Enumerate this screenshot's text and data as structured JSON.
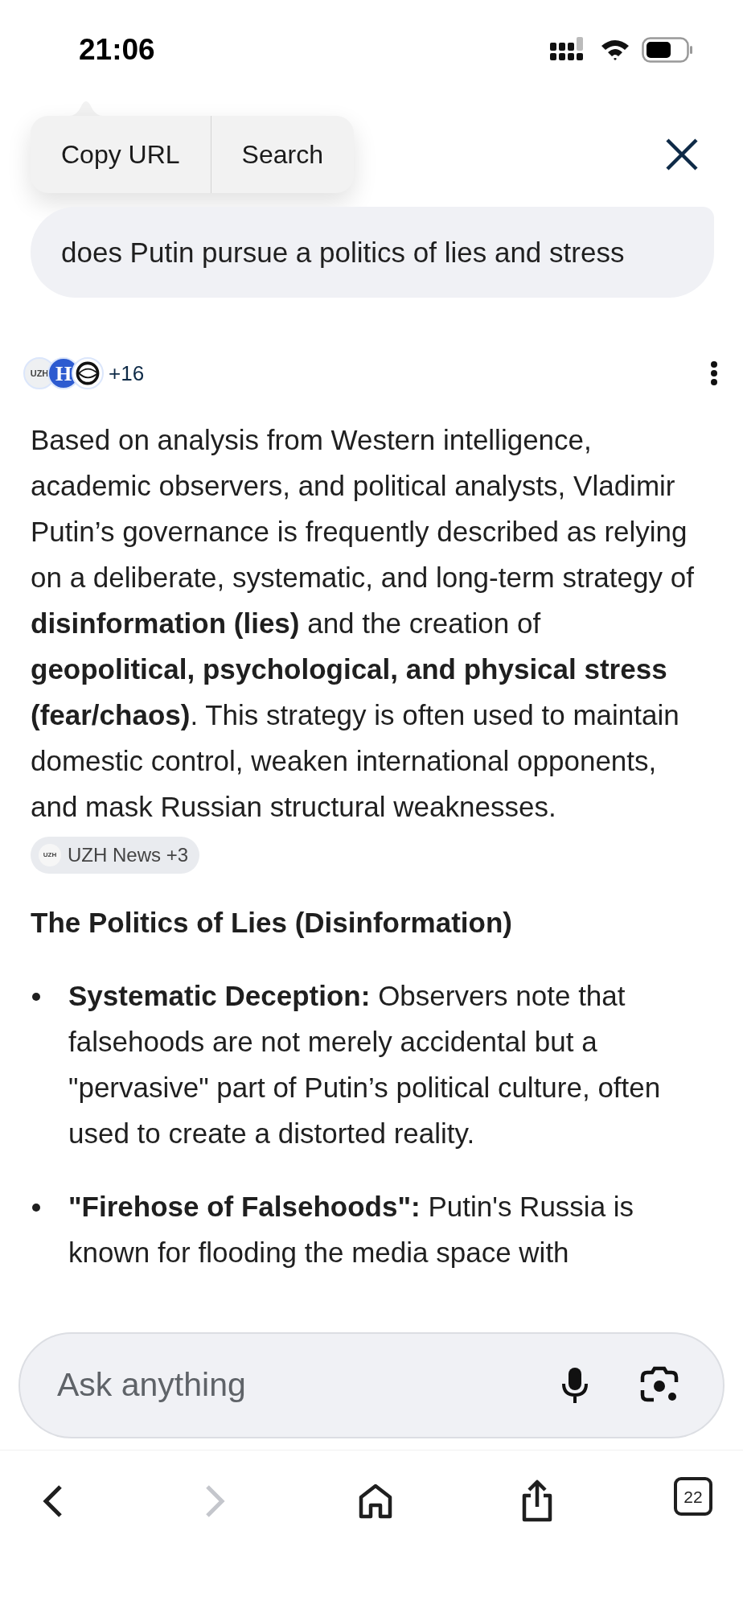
{
  "status_bar": {
    "time": "21:06"
  },
  "popup_menu": {
    "items": [
      "Copy URL",
      "Search"
    ]
  },
  "query": "does Putin pursue a politics of lies and stress",
  "sources": {
    "avatars": [
      {
        "kind": "text",
        "label": "UZH"
      },
      {
        "kind": "letter",
        "label": "H"
      },
      {
        "kind": "eye"
      }
    ],
    "more": "+16"
  },
  "answer": {
    "paragraph": "Based on analysis from Western intelligence, academic observers, and political analysts, Vladimir Putin’s governance is frequently described as relying on a deliberate, systematic, and long-term strategy of **disinformation (lies)** and the creation of **geopolitical, psychological, and physical stress (fear/chaos)**. This strategy is often used to maintain domestic control, weaken international opponents, and mask Russian structural weaknesses.",
    "citation": {
      "icon_label": "UZH",
      "label": "UZH News +3"
    },
    "heading": "The Politics of Lies (Disinformation)",
    "bullets": [
      {
        "label": "Systematic Deception:",
        "text": "Observers note that falsehoods are not merely accidental but a \"pervasive\" part of Putin’s political culture, often used to create a distorted reality."
      },
      {
        "label": "\"Firehose of Falsehoods\":",
        "text": "Putin's Russia is known for flooding the media space with"
      }
    ]
  },
  "ask_field": {
    "placeholder": "Ask anything"
  },
  "nav": [
    {
      "kind": "back",
      "disabled": false
    },
    {
      "kind": "forward",
      "disabled": true
    },
    {
      "kind": "home",
      "disabled": false
    },
    {
      "kind": "share",
      "disabled": false
    },
    {
      "kind": "tabs",
      "disabled": false,
      "label": "22"
    }
  ]
}
